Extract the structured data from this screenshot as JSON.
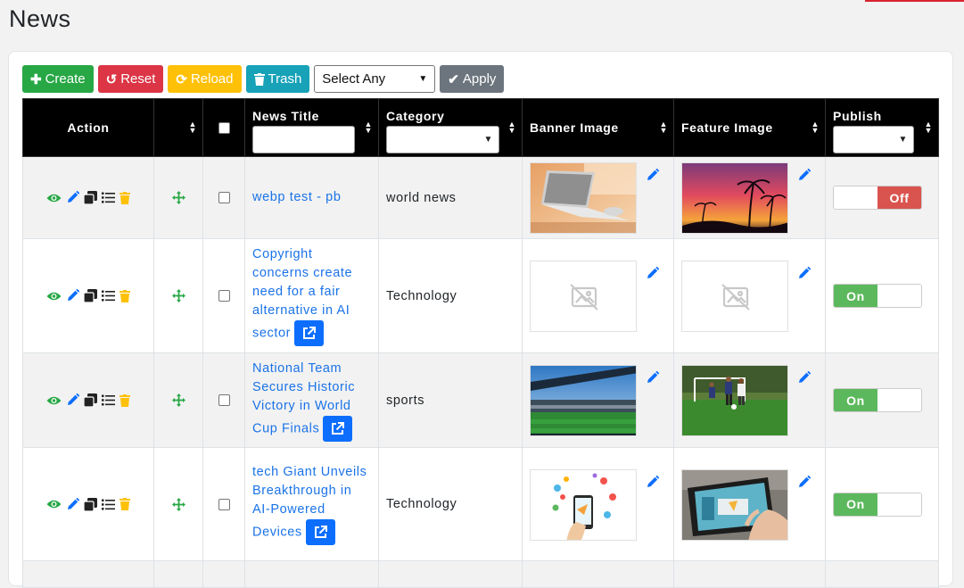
{
  "page": {
    "title": "News"
  },
  "toolbar": {
    "create_label": "Create",
    "reset_label": "Reset",
    "reload_label": "Reload",
    "trash_label": "Trash",
    "bulk_select": {
      "selected": "Select Any"
    },
    "apply_label": "Apply"
  },
  "table": {
    "headers": {
      "action": "Action",
      "news_title": "News Title",
      "category": "Category",
      "banner_image": "Banner Image",
      "feature_image": "Feature Image",
      "publish": "Publish"
    },
    "rows": [
      {
        "title": "webp test - pb",
        "category": "world news",
        "publish": "Off",
        "external_link": false,
        "banner": "laptop-photo",
        "feature": "sunset-palms-photo"
      },
      {
        "title": "Copyright concerns create need for a fair alternative in AI sector",
        "category": "Technology",
        "publish": "On",
        "external_link": true,
        "banner": "image-placeholder",
        "feature": "image-placeholder"
      },
      {
        "title": "National Team Secures Historic Victory in World Cup Finals",
        "category": "sports",
        "publish": "On",
        "external_link": true,
        "banner": "stadium-photo",
        "feature": "football-players-photo"
      },
      {
        "title": "tech Giant Unveils Breakthrough in AI-Powered Devices",
        "category": "Technology",
        "publish": "On",
        "external_link": true,
        "banner": "phone-apps-illustration",
        "feature": "tablet-touch-photo"
      }
    ]
  },
  "colors": {
    "accent": "#d9232d",
    "link": "#1a73e8",
    "on": "#5cb85c",
    "off": "#d9534f",
    "view": "#28a745",
    "edit": "#0d6efd",
    "delete": "#ffc107"
  }
}
